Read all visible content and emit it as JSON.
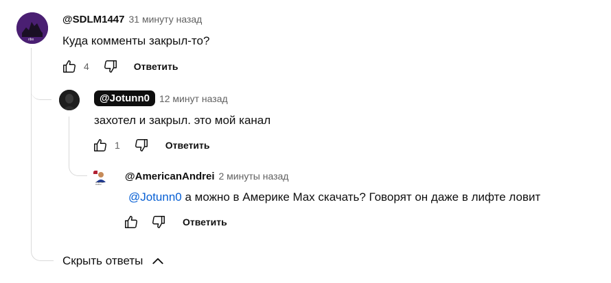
{
  "comment": {
    "handle": "@SDLM1447",
    "time": "31 минуту назад",
    "text": "Куда комменты закрыл-то?",
    "likes": "4",
    "reply_label": "Ответить",
    "avatar_text": "ribo"
  },
  "reply1": {
    "handle": "@Jotunn0",
    "time": "12 минут назад",
    "text": "захотел и закрыл. это мой канал",
    "likes": "1",
    "reply_label": "Ответить"
  },
  "reply2": {
    "handle": "@AmericanAndrei",
    "time": "2 минуты назад",
    "mention": "@Jotunn0",
    "text": " а можно в Америке Max скачать? Говорят он даже в лифте ловит",
    "reply_label": "Ответить",
    "avatar_text": "American Andrei"
  },
  "hide_replies_label": "Скрыть ответы",
  "colors": {
    "mention": "#065fd4",
    "badge_bg": "#0f0f0f",
    "avatar_purple": "#5b2a86"
  }
}
